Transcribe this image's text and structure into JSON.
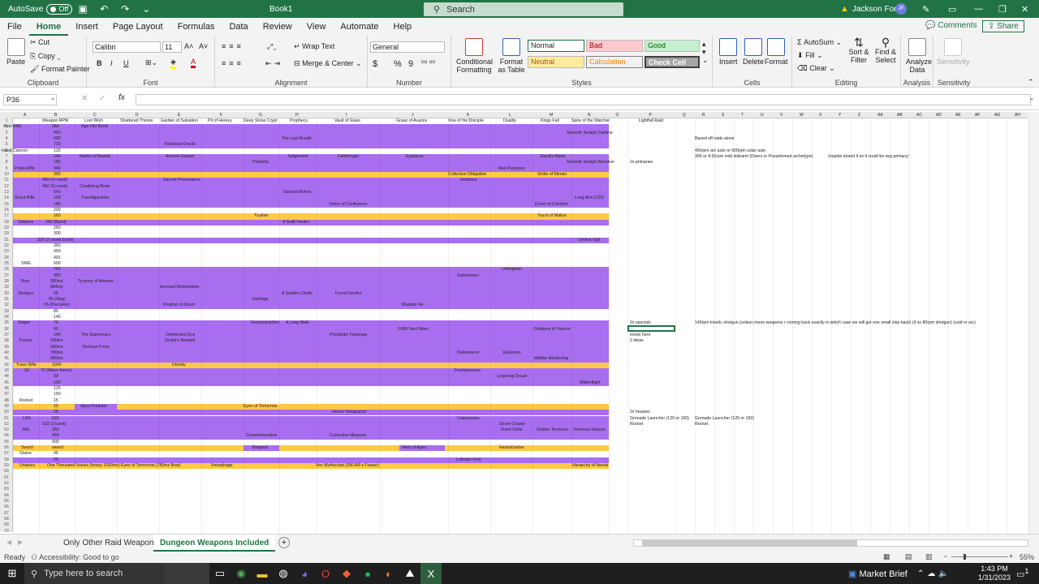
{
  "titlebar": {
    "autosave_label": "AutoSave",
    "autosave_state": "Off",
    "book_title": "Book1",
    "search_placeholder": "Search",
    "warning_icon": "warning-icon",
    "user_name": "Jackson Ford",
    "user_initials": "JF"
  },
  "menu": {
    "items": [
      "File",
      "Home",
      "Insert",
      "Page Layout",
      "Formulas",
      "Data",
      "Review",
      "View",
      "Automate",
      "Help"
    ],
    "comments_label": "Comments",
    "share_label": "Share"
  },
  "ribbon": {
    "clipboard": {
      "paste": "Paste",
      "cut": "Cut",
      "copy": "Copy",
      "format_painter": "Format Painter",
      "label": "Clipboard"
    },
    "font": {
      "font_name": "Calibri",
      "font_size": "11",
      "bold": "B",
      "italic": "I",
      "underline": "U",
      "label": "Font"
    },
    "alignment": {
      "wrap_text": "Wrap Text",
      "merge_center": "Merge & Center",
      "label": "Alignment"
    },
    "number": {
      "format": "General",
      "currency": "$",
      "percent": "%",
      "comma": "9",
      "label": "Number"
    },
    "styles": {
      "conditional": "Conditional Formatting",
      "format_table": "Format as Table",
      "normal": "Normal",
      "bad": "Bad",
      "good": "Good",
      "neutral": "Neutral",
      "calculation": "Calculation",
      "check_cell": "Check Cell",
      "label": "Styles"
    },
    "cells": {
      "insert": "Insert",
      "delete": "Delete",
      "format": "Format",
      "label": "Cells"
    },
    "editing": {
      "autosum": "AutoSum",
      "fill": "Fill",
      "clear": "Clear",
      "sort_filter": "Sort & Filter",
      "find_select": "Find & Select",
      "label": "Editing"
    },
    "analysis": {
      "analyze": "Analyze Data",
      "label": "Analysis"
    },
    "sensitivity": {
      "sensitivity": "Sensitivity",
      "label": "Sensitivity"
    }
  },
  "formula_bar": {
    "cell_ref": "P36",
    "cancel": "✕",
    "enter": "✓",
    "fx": "fx",
    "value": ""
  },
  "sheet": {
    "columns": [
      "A",
      "B",
      "C",
      "D",
      "E",
      "F",
      "G",
      "H",
      "I",
      "J",
      "K",
      "L",
      "M",
      "N",
      "O",
      "P",
      "Q",
      "R",
      "S",
      "T",
      "U",
      "V",
      "W",
      "X",
      "Y",
      "Z",
      "AA",
      "AB",
      "AC",
      "AD",
      "AE",
      "AF",
      "AG",
      "AH"
    ],
    "header_row": [
      "Weapon RPM",
      "Lost Wish",
      "Shattered Throne",
      "Garden of Salvation",
      "Pit of Heresy",
      "Deep Stone Crypt",
      "Prophecy",
      "Vault of Glass",
      "Grasp of Avarice",
      "Vow of the Disciple",
      "Duality",
      "Kings Fall",
      "Spire of the Watcher",
      "",
      "Lightfall Raid"
    ],
    "rows": [
      {
        "n": "2",
        "fill": "purple",
        "cells": [
          [
            "Auto Rifle",
            4
          ],
          [
            "360",
            64
          ],
          [
            "Age-Old Bond",
            100
          ]
        ]
      },
      {
        "n": "3",
        "fill": "purple",
        "cells": [
          [
            "450",
            66
          ],
          [
            "Seventh Seraph Carbine",
            698
          ]
        ]
      },
      {
        "n": "4",
        "fill": "purple",
        "cells": [
          [
            "600",
            66
          ],
          [
            "The Last Breath",
            347
          ],
          [
            "Based off raids alone",
            856
          ]
        ]
      },
      {
        "n": "5",
        "fill": "purple",
        "cells": [
          [
            "720",
            66
          ],
          [
            "Reckless Oracle",
            203
          ]
        ]
      },
      {
        "n": "6",
        "fill": "white",
        "cells": [
          [
            "Hand Cannon",
            2
          ],
          [
            "120",
            66
          ],
          [
            "450rpm arc auto or 600rpm solar auto",
            856
          ]
        ]
      },
      {
        "n": "7",
        "fill": "purple",
        "cells": [
          [
            "140",
            66
          ],
          [
            "Nation of Beasts",
            98
          ],
          [
            "Ancient Gospel",
            204
          ],
          [
            "Judgement",
            354
          ],
          [
            "Fatebringer",
            416
          ],
          [
            "Eyasluna",
            500
          ],
          [
            "Zaouli's Bane",
            665
          ],
          [
            "300 or 4.91rpm void sidearm (Dares or Posseboned archetype)",
            856
          ],
          [
            "(maybe strand if so it could be seg primary)",
            1020
          ]
        ]
      },
      {
        "n": "8",
        "fill": "purple",
        "cells": [
          [
            "180",
            66
          ],
          [
            "Posterity",
            311
          ],
          [
            "Seventh Seraph Revolver",
            698
          ],
          [
            "2x primaries",
            776
          ]
        ]
      },
      {
        "n": "9",
        "fill": "purple",
        "cells": [
          [
            "Pulse Rifle",
            18
          ],
          [
            "340",
            66
          ],
          [
            "Neo Purposes",
            614
          ]
        ]
      },
      {
        "n": "10",
        "fill": "orange",
        "cells": [
          [
            "390",
            66
          ],
          [
            "Collective Obligation",
            552
          ],
          [
            "Smite of Merain",
            662
          ]
        ]
      },
      {
        "n": "11",
        "fill": "purple",
        "cells": [
          [
            "450 (4 round)",
            52
          ],
          [
            "Sacred Provenance",
            201
          ],
          [
            "Insidious",
            567
          ]
        ]
      },
      {
        "n": "12",
        "fill": "purple",
        "cells": [
          [
            "450 (3 round)",
            52
          ],
          [
            "Chattering Bone",
            98
          ]
        ]
      },
      {
        "n": "13",
        "fill": "purple",
        "cells": [
          [
            "540",
            66
          ],
          [
            "Darkest Before",
            349
          ]
        ]
      },
      {
        "n": "14",
        "fill": "purple",
        "cells": [
          [
            "Scout Rifle",
            18
          ],
          [
            "150",
            66
          ],
          [
            "Transfiguration",
            100
          ],
          [
            "Long Arm (120)",
            708
          ]
        ]
      },
      {
        "n": "15",
        "fill": "purple",
        "cells": [
          [
            "180",
            66
          ],
          [
            "Vision of Confluence",
            405
          ],
          [
            "Doom of Chelchis",
            659
          ]
        ]
      },
      {
        "n": "16",
        "fill": "white",
        "cells": [
          [
            "200",
            66
          ]
        ]
      },
      {
        "n": "17",
        "fill": "orange",
        "cells": [
          [
            "260",
            66
          ],
          [
            "Trustee",
            313
          ],
          [
            "Touch of Malice",
            662
          ]
        ]
      },
      {
        "n": "18",
        "fill": "purple",
        "cells": [
          [
            "Sidearm",
            22
          ],
          [
            "260 (Burst)",
            56
          ],
          [
            "A Swift Verdict",
            348
          ]
        ]
      },
      {
        "n": "19",
        "fill": "white",
        "cells": [
          [
            "260",
            66
          ]
        ]
      },
      {
        "n": "20",
        "fill": "white",
        "cells": [
          [
            "300",
            66
          ]
        ]
      },
      {
        "n": "21",
        "fill": "purple",
        "cells": [
          [
            "325 (2 round burst)",
            46
          ],
          [
            "Liminal Vigil",
            712
          ]
        ]
      },
      {
        "n": "22",
        "fill": "white",
        "cells": [
          [
            "360",
            66
          ]
        ]
      },
      {
        "n": "23",
        "fill": "white",
        "cells": [
          [
            "450",
            66
          ]
        ]
      },
      {
        "n": "24",
        "fill": "white",
        "cells": [
          [
            "491",
            66
          ]
        ]
      },
      {
        "n": "25",
        "fill": "white",
        "cells": [
          [
            "SMG",
            26
          ],
          [
            "600",
            66
          ]
        ]
      },
      {
        "n": "26",
        "fill": "purple",
        "cells": [
          [
            "750",
            66
          ],
          [
            "Unforgiven",
            618
          ]
        ]
      },
      {
        "n": "27",
        "fill": "purple",
        "cells": [
          [
            "900",
            66
          ],
          [
            "Submission",
            563
          ]
        ]
      },
      {
        "n": "28",
        "fill": "purple",
        "cells": [
          [
            "Bow",
            26
          ],
          [
            "580ms",
            62
          ],
          [
            "Tyranny of Heaven",
            96
          ]
        ]
      },
      {
        "n": "29",
        "fill": "purple",
        "cells": [
          [
            "684ms",
            62
          ],
          [
            "Accrued Redemption",
            197
          ]
        ]
      },
      {
        "n": "30",
        "fill": "purple",
        "cells": [
          [
            "Shotgun",
            22
          ],
          [
            "55",
            66
          ],
          [
            "A Sudden Death",
            347
          ],
          [
            "Found Verdict",
            413
          ]
        ]
      },
      {
        "n": "31",
        "fill": "purple",
        "cells": [
          [
            "65 (Slug)",
            60
          ],
          [
            "Heritage",
            311
          ]
        ]
      },
      {
        "n": "32",
        "fill": "purple",
        "cells": [
          [
            "65 (Precision)",
            54
          ],
          [
            "Prophet of Doom",
            201
          ],
          [
            "Mutador 64",
            495
          ]
        ]
      },
      {
        "n": "33",
        "fill": "white",
        "cells": [
          [
            "80",
            66
          ]
        ]
      },
      {
        "n": "34",
        "fill": "white",
        "cells": [
          [
            "140",
            66
          ]
        ]
      },
      {
        "n": "35",
        "fill": "purple",
        "cells": [
          [
            "Sniper",
            22
          ],
          [
            "72",
            66
          ],
          [
            "Deconstruction",
            309
          ],
          [
            "A Long Walk",
            352
          ],
          [
            "2x specials",
            776
          ],
          [
            "140rpm kinetic shotgun (unless moon weapons r coming back exactly in which case we will get one small chip back) (if so 80rpm shotgun) (void or arc)",
            856
          ]
        ]
      },
      {
        "n": "36",
        "fill": "purple",
        "cells": [
          [
            "90",
            66
          ],
          [
            "1000-Yard Stare",
            490
          ],
          [
            "Defiance of Yasmin",
            658
          ]
        ]
      },
      {
        "n": "37",
        "fill": "purple",
        "cells": [
          [
            "140",
            66
          ],
          [
            "The Supremacy",
            100
          ],
          [
            "Omniscient Eye",
            204
          ],
          [
            "Prosdytko Flavonga",
            406
          ],
          [
            "exotic here",
            776
          ]
        ]
      },
      {
        "n": "38",
        "fill": "purple",
        "cells": [
          [
            "Fusion",
            24
          ],
          [
            "500ms",
            62
          ],
          [
            "Zealot's Reward",
            203
          ],
          [
            "2 ideas",
            776
          ]
        ]
      },
      {
        "n": "39",
        "fill": "purple",
        "cells": [
          [
            "660ms",
            62
          ],
          [
            "Techeun Force",
            101
          ]
        ]
      },
      {
        "n": "40",
        "fill": "purple",
        "cells": [
          [
            "780ms",
            62
          ],
          [
            "Deliverance",
            563
          ],
          [
            "Epicurian",
            620
          ]
        ]
      },
      {
        "n": "41",
        "fill": "purple",
        "cells": [
          [
            "960ms",
            62
          ],
          [
            "Midlise Reckoning",
            658
          ]
        ]
      },
      {
        "n": "42",
        "fill": "orange",
        "cells": [
          [
            "Trace Rifle",
            20
          ],
          [
            "1000",
            64
          ],
          [
            "Divinity",
            212
          ]
        ]
      },
      {
        "n": "43",
        "fill": "purple",
        "cells": [
          [
            "GL",
            30
          ],
          [
            "72 (Wave frame)",
            50
          ],
          [
            "Forebearance",
            560
          ]
        ]
      },
      {
        "n": "44",
        "fill": "purple",
        "cells": [
          [
            "90",
            66
          ],
          [
            "Lingering Dread",
            612
          ]
        ]
      },
      {
        "n": "45",
        "fill": "purple",
        "cells": [
          [
            "100",
            66
          ],
          [
            "Wilderflight",
            714
          ]
        ]
      },
      {
        "n": "46",
        "fill": "white",
        "cells": [
          [
            "120",
            66
          ]
        ]
      },
      {
        "n": "47",
        "fill": "white",
        "cells": [
          [
            "150",
            66
          ]
        ]
      },
      {
        "n": "48",
        "fill": "white",
        "cells": [
          [
            "Rocket",
            24
          ],
          [
            "15",
            66
          ]
        ]
      },
      {
        "n": "49",
        "fill": "mixed49",
        "cells": [
          [
            "20",
            66
          ],
          [
            "Apex Predator",
            99
          ],
          [
            "Eyes of Tomorrow",
            300
          ]
        ]
      },
      {
        "n": "50",
        "fill": "purple",
        "cells": [
          [
            "25",
            66
          ],
          [
            "Hezen Vengeance",
            409
          ],
          [
            "2x heavies",
            776
          ]
        ]
      },
      {
        "n": "51",
        "fill": "purple",
        "cells": [
          [
            "LFR",
            28
          ],
          [
            "533",
            64
          ],
          [
            "Cataclysmic",
            563
          ],
          [
            "Grenade Launcher (120 or 150)",
            776
          ],
          [
            "Grenade Launcher (120 or 150)",
            856
          ]
        ]
      },
      {
        "n": "52",
        "fill": "purple",
        "cells": [
          [
            "533 (3 burst)",
            52
          ],
          [
            "Storm Chaser",
            615
          ],
          [
            "Rocket",
            776
          ],
          [
            "Rocket",
            856
          ]
        ]
      },
      {
        "n": "53",
        "fill": "purple",
        "cells": [
          [
            "MG",
            28
          ],
          [
            "360",
            64
          ],
          [
            "Fixed Odds",
            617
          ],
          [
            "Outline Terminus",
            661
          ],
          [
            "Terminus Horizon",
            706
          ]
        ]
      },
      {
        "n": "54",
        "fill": "purple",
        "cells": [
          [
            "450",
            64
          ],
          [
            "Commemoration",
            303
          ],
          [
            "Corrective Measure",
            406
          ]
        ]
      },
      {
        "n": "55",
        "fill": "white",
        "cells": [
          [
            "900",
            64
          ]
        ]
      },
      {
        "n": "56",
        "fill": "mixed56",
        "cells": [
          [
            "Sword",
            26
          ],
          [
            "sword",
            64
          ],
          [
            "Bequest",
            311
          ],
          [
            "Hero of Ages",
            495
          ],
          [
            "Heartshadow",
            615
          ]
        ]
      },
      {
        "n": "57",
        "fill": "white",
        "cells": [
          [
            "Glaive",
            24
          ],
          [
            "45",
            66
          ]
        ]
      },
      {
        "n": "58",
        "fill": "purple",
        "cells": [
          [
            "55",
            66
          ],
          [
            "Lubraes Ruin",
            562
          ]
        ]
      },
      {
        "n": "59",
        "fill": "orange",
        "cells": [
          [
            "Uniques",
            24
          ],
          [
            "One Thousand Voices (heavy 1000ms) Eyes of Tomorrow (780ms Bow)",
            58
          ],
          [
            "Xenophage",
            260
          ],
          [
            "Vex Mythoclast (390 AR s Fusion)",
            389
          ],
          [
            "Hierarchy of Needs",
            705
          ]
        ]
      }
    ]
  },
  "sheet_tabs": [
    "Only Other Raid Weapons",
    "Dungeon Weapons Included"
  ],
  "active_tab": "Dungeon Weapons Included",
  "statusbar": {
    "ready": "Ready",
    "accessibility": "Accessibility: Good to go",
    "zoom": "55%"
  },
  "taskbar": {
    "search_placeholder": "Type here to search",
    "market": "Market Brief",
    "time": "1:43 PM",
    "date": "1/31/2023",
    "notification_count": "1"
  },
  "colors": {
    "excel_green": "#217346",
    "purple": "#a96ef0",
    "orange": "#ffc947",
    "white": "#ffffff"
  }
}
